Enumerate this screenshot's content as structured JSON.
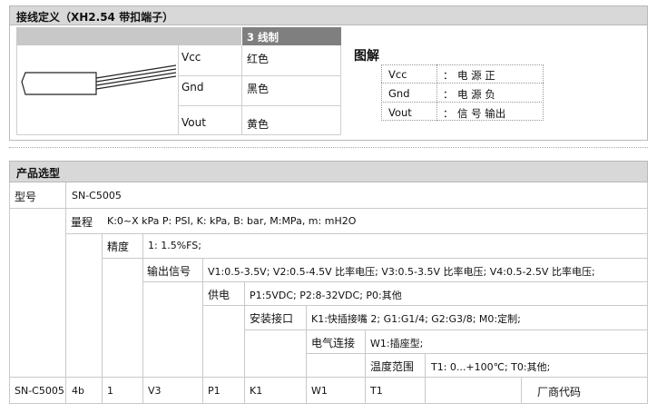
{
  "section1": {
    "title": "接线定义（XH2.54 带扣端子）",
    "wire_header": "3 线制",
    "wires": [
      {
        "signal": "Vcc",
        "color": "红色"
      },
      {
        "signal": "Gnd",
        "color": "黑色"
      },
      {
        "signal": "Vout",
        "color": "黄色"
      }
    ],
    "legend_title": "图解",
    "legend": [
      {
        "key": "Vcc",
        "sep": "：",
        "value": "电 源 正"
      },
      {
        "key": "Gnd",
        "sep": "：",
        "value": "电 源 负"
      },
      {
        "key": "Vout",
        "sep": "：",
        "value": "信 号 输出"
      }
    ]
  },
  "selection": {
    "title": "产品选型",
    "model_label": "型号",
    "model_value": "SN-C5005",
    "range_label": "量程",
    "range_value": "K:0~X kPa     P: PSI,    K: kPa,    B: bar,    M:MPa,    m: mH2O",
    "accuracy_label": "精度",
    "accuracy_value": "1: 1.5%FS;",
    "output_label": "输出信号",
    "output_value": "V1:0.5-3.5V;    V2:0.5-4.5V 比率电压;    V3:0.5-3.5V 比率电压;    V4:0.5-2.5V 比率电压;",
    "power_label": "供电",
    "power_value": "P1:5VDC;    P2:8-32VDC;    P0:其他",
    "mount_label": "安装接口",
    "mount_value": "K1:快插接嘴 2;    G1:G1/4;    G2:G3/8;      M0:定制;",
    "elec_label": "电气连接",
    "elec_value": "W1:插座型;",
    "temp_label": "温度范围",
    "temp_value": "T1: 0...+100℃;    T0:其他;",
    "example": [
      "SN-C5005",
      "4b",
      "1",
      "V3",
      "P1",
      "K1",
      "W1",
      "T1",
      "",
      "厂商代码"
    ]
  }
}
